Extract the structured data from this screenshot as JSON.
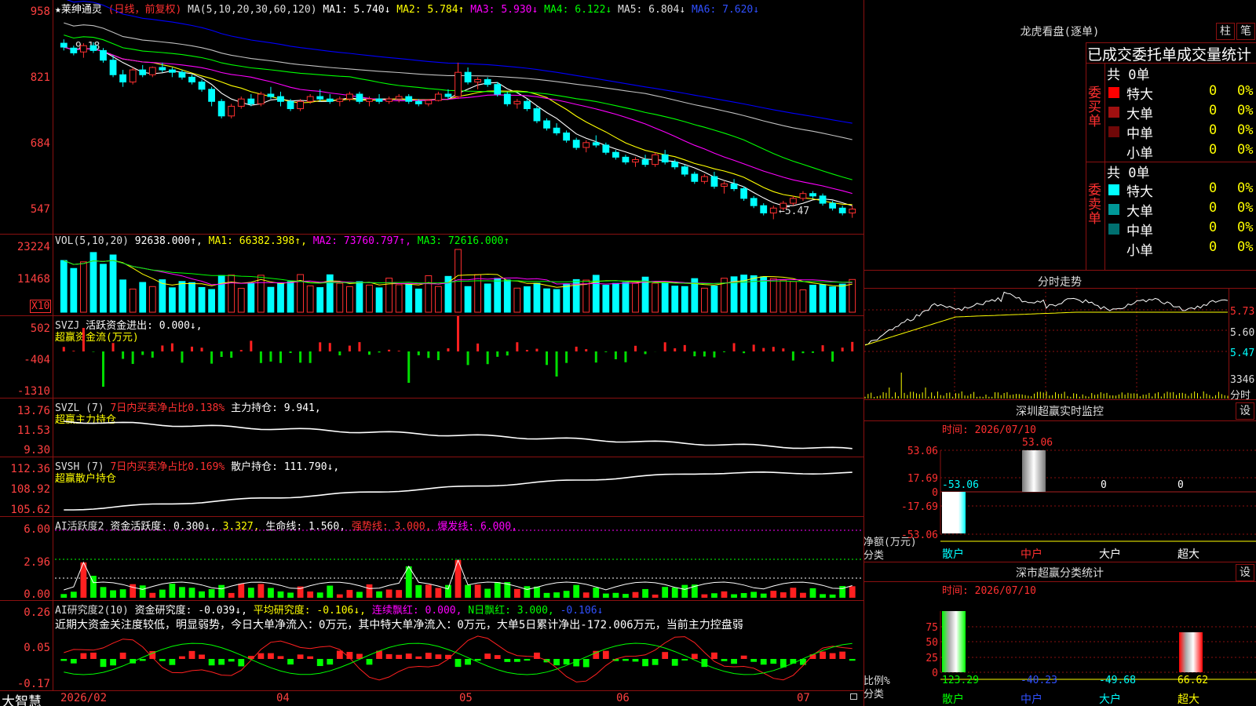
{
  "main_chart": {
    "star": "★",
    "stock_name": "莱绅通灵",
    "period": "(日线，前复权)",
    "ma_label": "MA(5,10,20,30,60,120)",
    "ma1": "MA1: 5.740↓",
    "ma2": "MA2: 5.784↑",
    "ma3": "MA3: 5.930↓",
    "ma4": "MA4: 6.122↓",
    "ma5": "MA5: 6.804↓",
    "ma6": "MA6: 7.620↓",
    "y_ticks": [
      "958",
      "821",
      "684",
      "547"
    ],
    "low_label": "←5.47",
    "high_label": "9.18"
  },
  "vol_panel": {
    "label": "VOL(5,10,20)",
    "value": "92638.000↑,",
    "ma1": "MA1: 66382.398↑,",
    "ma2": "MA2: 73760.797↑,",
    "ma3": "MA3: 72616.000↑",
    "y_ticks": [
      "23224",
      "11468"
    ],
    "unit": "X10"
  },
  "svzj_panel": {
    "label": "SVZJ",
    "value": "活跃资金进出: 0.000↓,",
    "name": "超赢资金流(万元)",
    "y_ticks": [
      "502",
      "-404",
      "-1310"
    ]
  },
  "svzl_panel": {
    "label": "SVZL (7)",
    "ratio": "7日内买卖净占比0.138%",
    "value": "主力持仓: 9.941,",
    "name": "超赢主力持仓",
    "y_ticks": [
      "13.76",
      "11.53",
      "9.30"
    ]
  },
  "svsh_panel": {
    "label": "SVSH (7)",
    "ratio": "7日内买卖净占比0.169%",
    "value": "散户持仓: 111.790↓,",
    "name": "超赢散户持仓",
    "y_ticks": [
      "112.36",
      "108.92",
      "105.62"
    ]
  },
  "ai_active_panel": {
    "label": "AI活跃度2",
    "v1": "资金活跃度: 0.300↓,",
    "v2": "3.327,",
    "v3": "生命线: 1.560,",
    "v4": "强势线: 3.000,",
    "v5": "爆发线: 6.000,",
    "y_ticks": [
      "6.00",
      "2.96",
      "0.00"
    ]
  },
  "ai_research_panel": {
    "label": "AI研究度2(10)",
    "v1": "资金研究度: -0.039↓,",
    "v2": "平均研究度: -0.106↓,",
    "v3": "连续飘红: 0.000,",
    "v4": "N日飘红: 3.000,",
    "v5": "-0.106↓",
    "comment": "近期大资金关注度较低，明显弱势，今日大单净流入：0万元，其中特大单净流入：0万元，大单5日累计净出-172.006万元，当前主力控盘弱",
    "y_ticks": [
      "0.26",
      "0.05",
      "-0.17"
    ]
  },
  "x_axis": {
    "brand": "大智慧",
    "labels": [
      "2026/02",
      "04",
      "05",
      "06",
      "07"
    ]
  },
  "right_panel": {
    "lhb_title": "龙虎看盘(逐单)",
    "btn_zhu": "柱",
    "btn_bi": "笔",
    "stat_title": "已成交委托单成交量统计",
    "buy_label": "委买单",
    "sell_label": "委卖单",
    "buy_total": "共 0单",
    "sell_total": "共 0单",
    "buy_rows": [
      {
        "name": "特大",
        "count": "0",
        "pct": "0%",
        "color": "#ff0000"
      },
      {
        "name": "大单",
        "count": "0",
        "pct": "0%",
        "color": "#a01010"
      },
      {
        "name": "中单",
        "count": "0",
        "pct": "0%",
        "color": "#700808"
      },
      {
        "name": "小单",
        "count": "0",
        "pct": "0%",
        "color": ""
      }
    ],
    "sell_rows": [
      {
        "name": "特大",
        "count": "0",
        "pct": "0%",
        "color": "#00ffff"
      },
      {
        "name": "大单",
        "count": "0",
        "pct": "0%",
        "color": "#009898"
      },
      {
        "name": "中单",
        "count": "0",
        "pct": "0%",
        "color": "#007070"
      },
      {
        "name": "小单",
        "count": "0",
        "pct": "0%",
        "color": ""
      }
    ],
    "fenshi_title": "分时走势",
    "fenshi_ticks": [
      "5.73",
      "5.60",
      "5.47"
    ],
    "fenshi_vol": "3346",
    "fenshi_unit": "分时",
    "sz_monitor_title": "深圳超赢实时监控",
    "btn_set": "设",
    "monitor_time": "时间: 2026/07/10",
    "monitor_ticks": [
      "53.06",
      "17.69",
      "0",
      "-17.69",
      "-53.06"
    ],
    "monitor_values": [
      "-53.06",
      "53.06",
      "0",
      "0"
    ],
    "monitor_ylabel": "净额(万元)",
    "monitor_xlabel": "分类",
    "categories": [
      "散户",
      "中户",
      "大户",
      "超大"
    ],
    "sz_class_title": "深市超赢分类统计",
    "class_time": "时间: 2026/07/10",
    "class_ticks": [
      "75",
      "50",
      "25",
      "0"
    ],
    "class_values": [
      "123.29",
      "-40.23",
      "-49.68",
      "66.62"
    ],
    "class_ylabel": "比例%",
    "class_xlabel": "分类"
  },
  "colors": {
    "up": "#ff3030",
    "down": "#00ffff",
    "grid": "#8a1010",
    "ma1": "#ffffff",
    "ma2": "#ffff00",
    "ma3": "#ff00ff",
    "ma4": "#00ff00",
    "ma5": "#c0c0c0",
    "ma6": "#0000ff"
  },
  "chart_data": {
    "type": "candlestick",
    "title": "莱绅通灵",
    "y_range": [
      5.3,
      9.7
    ],
    "ohlc": [
      [
        9.1,
        9.18,
        8.95,
        9.02
      ],
      [
        9.0,
        9.05,
        8.85,
        8.9
      ],
      [
        8.92,
        9.1,
        8.8,
        9.05
      ],
      [
        9.05,
        9.12,
        8.9,
        8.95
      ],
      [
        8.95,
        9.0,
        8.7,
        8.75
      ],
      [
        8.75,
        8.85,
        8.4,
        8.45
      ],
      [
        8.45,
        8.55,
        8.2,
        8.3
      ],
      [
        8.3,
        8.6,
        8.25,
        8.55
      ],
      [
        8.55,
        8.65,
        8.4,
        8.45
      ],
      [
        8.45,
        8.62,
        8.4,
        8.6
      ],
      [
        8.6,
        8.7,
        8.5,
        8.55
      ],
      [
        8.55,
        8.6,
        8.4,
        8.5
      ],
      [
        8.5,
        8.55,
        8.35,
        8.4
      ],
      [
        8.4,
        8.45,
        8.25,
        8.3
      ],
      [
        8.3,
        8.35,
        8.1,
        8.15
      ],
      [
        8.15,
        8.2,
        7.8,
        7.9
      ],
      [
        7.9,
        7.95,
        7.55,
        7.6
      ],
      [
        7.6,
        7.85,
        7.55,
        7.8
      ],
      [
        7.8,
        8.0,
        7.75,
        7.95
      ],
      [
        7.95,
        8.05,
        7.8,
        7.85
      ],
      [
        7.85,
        8.1,
        7.8,
        8.05
      ],
      [
        8.05,
        8.2,
        7.95,
        8.0
      ],
      [
        8.0,
        8.1,
        7.8,
        7.9
      ],
      [
        7.9,
        7.95,
        7.7,
        7.75
      ],
      [
        7.75,
        7.95,
        7.7,
        7.9
      ],
      [
        7.9,
        8.05,
        7.85,
        8.0
      ],
      [
        8.0,
        8.15,
        7.9,
        7.95
      ],
      [
        7.95,
        8.05,
        7.85,
        7.9
      ],
      [
        7.9,
        8.0,
        7.8,
        7.95
      ],
      [
        7.95,
        8.1,
        7.9,
        8.05
      ],
      [
        8.05,
        8.1,
        7.85,
        7.9
      ],
      [
        7.9,
        8.0,
        7.8,
        7.95
      ],
      [
        7.95,
        8.05,
        7.85,
        7.9
      ],
      [
        7.9,
        8.0,
        7.85,
        7.95
      ],
      [
        7.95,
        8.05,
        7.88,
        8.0
      ],
      [
        8.0,
        8.05,
        7.85,
        7.9
      ],
      [
        7.9,
        7.95,
        7.8,
        7.85
      ],
      [
        7.85,
        7.95,
        7.8,
        7.92
      ],
      [
        7.92,
        8.1,
        7.9,
        8.05
      ],
      [
        8.05,
        8.15,
        7.95,
        8.0
      ],
      [
        8.0,
        8.7,
        7.95,
        8.5
      ],
      [
        8.5,
        8.6,
        8.25,
        8.3
      ],
      [
        8.3,
        8.4,
        8.15,
        8.35
      ],
      [
        8.35,
        8.4,
        8.2,
        8.25
      ],
      [
        8.25,
        8.3,
        8.0,
        8.05
      ],
      [
        8.05,
        8.1,
        7.8,
        7.85
      ],
      [
        7.85,
        7.95,
        7.75,
        7.9
      ],
      [
        7.9,
        7.95,
        7.7,
        7.75
      ],
      [
        7.75,
        7.8,
        7.45,
        7.5
      ],
      [
        7.5,
        7.55,
        7.3,
        7.35
      ],
      [
        7.35,
        7.45,
        7.2,
        7.25
      ],
      [
        7.25,
        7.3,
        7.05,
        7.1
      ],
      [
        7.1,
        7.15,
        6.9,
        6.95
      ],
      [
        6.95,
        7.1,
        6.85,
        7.05
      ],
      [
        7.05,
        7.2,
        6.95,
        7.0
      ],
      [
        7.0,
        7.05,
        6.8,
        6.85
      ],
      [
        6.85,
        6.9,
        6.7,
        6.75
      ],
      [
        6.75,
        6.8,
        6.6,
        6.65
      ],
      [
        6.65,
        6.75,
        6.55,
        6.7
      ],
      [
        6.7,
        6.8,
        6.55,
        6.6
      ],
      [
        6.6,
        6.85,
        6.55,
        6.8
      ],
      [
        6.8,
        6.9,
        6.6,
        6.65
      ],
      [
        6.65,
        6.7,
        6.5,
        6.55
      ],
      [
        6.55,
        6.6,
        6.35,
        6.4
      ],
      [
        6.4,
        6.45,
        6.2,
        6.25
      ],
      [
        6.25,
        6.4,
        6.2,
        6.35
      ],
      [
        6.35,
        6.45,
        6.1,
        6.15
      ],
      [
        6.15,
        6.25,
        6.0,
        6.2
      ],
      [
        6.2,
        6.3,
        6.05,
        6.1
      ],
      [
        6.1,
        6.15,
        5.85,
        5.9
      ],
      [
        5.9,
        5.95,
        5.7,
        5.75
      ],
      [
        5.75,
        5.8,
        5.55,
        5.6
      ],
      [
        5.6,
        5.75,
        5.47,
        5.7
      ],
      [
        5.7,
        5.85,
        5.65,
        5.8
      ],
      [
        5.8,
        5.95,
        5.75,
        5.9
      ],
      [
        5.9,
        6.05,
        5.85,
        6.0
      ],
      [
        6.0,
        6.05,
        5.9,
        5.95
      ],
      [
        5.95,
        6.0,
        5.75,
        5.8
      ],
      [
        5.8,
        5.85,
        5.65,
        5.7
      ],
      [
        5.7,
        5.75,
        5.55,
        5.6
      ],
      [
        5.6,
        5.75,
        5.5,
        5.68
      ]
    ]
  }
}
